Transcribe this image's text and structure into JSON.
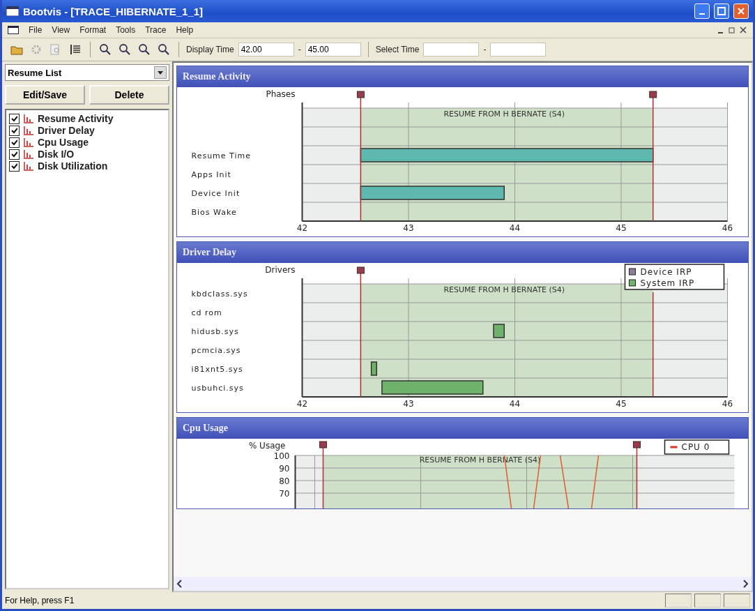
{
  "window": {
    "title": "Bootvis - [TRACE_HIBERNATE_1_1]"
  },
  "menu": [
    "File",
    "View",
    "Format",
    "Tools",
    "Trace",
    "Help"
  ],
  "toolbar": {
    "display_time_label": "Display Time",
    "display_from": "42.00",
    "dash_1": "-",
    "display_to": "45.00",
    "select_time_label": "Select Time",
    "dash_2": "-"
  },
  "sidebar": {
    "dropdown": "Resume List",
    "buttons": [
      "Edit/Save",
      "Delete"
    ],
    "items": [
      {
        "label": "Resume Activity",
        "checked": true
      },
      {
        "label": "Driver Delay",
        "checked": true
      },
      {
        "label": "Cpu Usage",
        "checked": true
      },
      {
        "label": "Disk I/O",
        "checked": true
      },
      {
        "label": "Disk Utilization",
        "checked": true
      }
    ]
  },
  "panels": [
    {
      "title": "Resume Activity",
      "timeline": {
        "ylabel": "Phases",
        "rows": [
          "Resume Time",
          "Apps Init",
          "Device Init",
          "Bios Wake"
        ],
        "xticks": [
          "42",
          "43",
          "44",
          "45",
          "46"
        ],
        "annotation": "RESUME FROM H BERNATE (S4)"
      }
    },
    {
      "title": "Driver Delay",
      "timeline": {
        "ylabel": "Drivers",
        "rows": [
          "kbdclass.sys",
          "cd rom",
          "hidusb.sys",
          "pcmcia.sys",
          "i81xnt5.sys",
          "usbuhci.sys"
        ],
        "xticks": [
          "42",
          "43",
          "44",
          "45",
          "46"
        ],
        "annotation": "RESUME FROM H BERNATE (S4)",
        "legend": [
          {
            "label": "Device IRP",
            "color": "#8a7f9c"
          },
          {
            "label": "System IRP",
            "color": "#6fb26c"
          }
        ]
      }
    }
  ],
  "cpu_panel": {
    "title": "Cpu Usage",
    "ylabel": "% Usage",
    "yticks": [
      "100",
      "90",
      "80",
      "70"
    ],
    "legend": "CPU 0",
    "annotation": "RESUME FROM H BERNATE (S4)"
  },
  "status_bar": {
    "text": "For Help, press F1"
  }
}
